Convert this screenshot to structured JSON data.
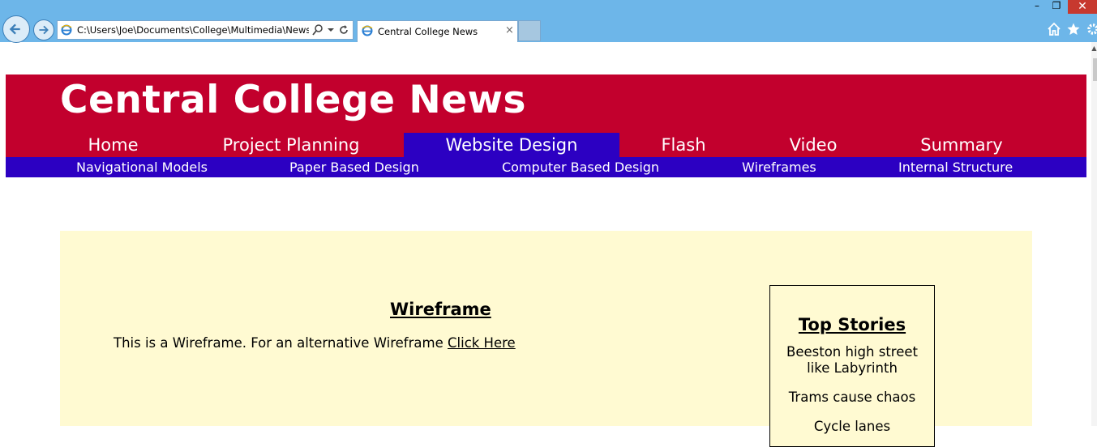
{
  "browser": {
    "address_url": "C:\\Users\\Joe\\Documents\\College\\Multimedia\\Newssi",
    "tab_title": "Central College News",
    "tab_close": "×",
    "window_controls": {
      "minimize": "–",
      "restore": "❐",
      "close": "✕"
    },
    "icons": [
      "back-arrow-icon",
      "forward-arrow-icon",
      "ie-logo-icon",
      "search-icon",
      "dropdown-icon",
      "refresh-icon",
      "home-icon",
      "favorites-star-icon",
      "settings-gear-icon"
    ],
    "accent_color": "#6db6e9"
  },
  "site": {
    "title": "Central College News",
    "header_color": "#c2002d",
    "nav_color": "#2c00c2",
    "main_nav": [
      {
        "label": "Home",
        "active": false
      },
      {
        "label": "Project Planning",
        "active": false
      },
      {
        "label": "Website Design",
        "active": true
      },
      {
        "label": "Flash",
        "active": false
      },
      {
        "label": "Video",
        "active": false
      },
      {
        "label": "Summary",
        "active": false
      }
    ],
    "sub_nav": [
      {
        "label": "Navigational Models"
      },
      {
        "label": "Paper Based Design"
      },
      {
        "label": "Computer Based Design"
      },
      {
        "label": "Wireframes"
      },
      {
        "label": "Internal Structure"
      }
    ]
  },
  "content": {
    "background_color": "#fffad2",
    "heading": "Wireframe",
    "intro_text": "This is a Wireframe. For an alternative Wireframe",
    "link_text": "Click Here",
    "top_stories": {
      "title": "Top Stories",
      "items": [
        "Beeston high street like Labyrinth",
        "Trams cause chaos",
        "Cycle lanes"
      ]
    }
  }
}
